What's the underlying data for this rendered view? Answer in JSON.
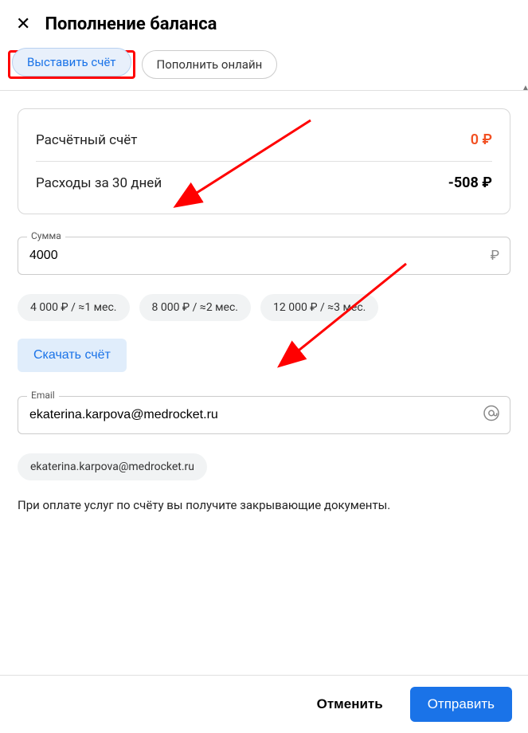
{
  "header": {
    "close_icon": "✕",
    "title": "Пополнение баланса"
  },
  "tabs": {
    "invoice": "Выставить счёт",
    "online": "Пополнить онлайн"
  },
  "balance": {
    "account_label": "Расчётный счёт",
    "account_value": "0 ₽",
    "expense_label": "Расходы за 30 дней",
    "expense_value": "-508 ₽"
  },
  "amount": {
    "label": "Сумма",
    "value": "4000",
    "currency": "₽"
  },
  "presets": [
    "4 000 ₽ / ≈1 мес.",
    "8 000 ₽ / ≈2 мес.",
    "12 000 ₽ / ≈3 мес."
  ],
  "download_label": "Скачать счёт",
  "email": {
    "label": "Email",
    "value": "ekaterina.karpova@medrocket.ru",
    "at_icon": "@"
  },
  "email_chip": "ekaterina.karpova@medrocket.ru",
  "info_text": "При оплате услуг по счёту вы получите закрывающие документы.",
  "footer": {
    "cancel": "Отменить",
    "submit": "Отправить"
  }
}
